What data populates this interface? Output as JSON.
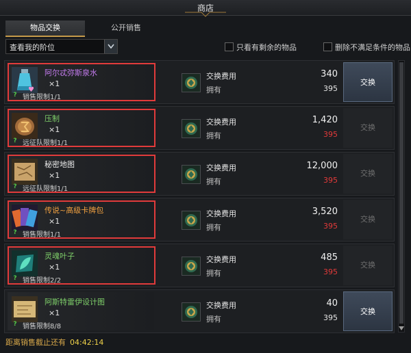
{
  "window": {
    "title": "商店"
  },
  "tabs": [
    {
      "label": "物品交换",
      "active": true
    },
    {
      "label": "公开销售",
      "active": false
    }
  ],
  "filter": {
    "selected": "查看我的阶位"
  },
  "checkboxes": [
    {
      "label": "只看有剩余的物品",
      "checked": false
    },
    {
      "label": "删除不满足条件的物品",
      "checked": false
    }
  ],
  "cost_label": "交换费用",
  "own_label": "拥有",
  "items": [
    {
      "name": "阿尔忒弥斯泉水",
      "name_color": "#c57cf0",
      "qty": "×1",
      "limit": "销售限制1/1",
      "cost": "340",
      "owned": "395",
      "affordable": true,
      "button": "交换",
      "icon": "potion-icon",
      "highlighted": true
    },
    {
      "name": "压制",
      "name_color": "#7fd06a",
      "qty": "×1",
      "limit": "远征队限制1/1",
      "cost": "1,420",
      "owned": "395",
      "affordable": false,
      "button": "交换",
      "icon": "rune-stone-icon",
      "highlighted": true
    },
    {
      "name": "秘密地图",
      "name_color": "#e8e8e8",
      "qty": "×1",
      "limit": "远征队限制1/1",
      "cost": "12,000",
      "owned": "395",
      "affordable": false,
      "button": "交换",
      "icon": "map-icon",
      "highlighted": true
    },
    {
      "name": "传说~高级卡牌包",
      "name_color": "#f0a040",
      "qty": "×1",
      "limit": "销售限制1/1",
      "cost": "3,520",
      "owned": "395",
      "affordable": false,
      "button": "交换",
      "icon": "card-pack-icon",
      "highlighted": true
    },
    {
      "name": "灵魂叶子",
      "name_color": "#7fd06a",
      "qty": "×1",
      "limit": "销售限制2/2",
      "cost": "485",
      "owned": "395",
      "affordable": false,
      "button": "交换",
      "icon": "soul-leaf-icon",
      "highlighted": true
    },
    {
      "name": "阿斯特雷伊设计图",
      "name_color": "#7fd06a",
      "qty": "×1",
      "limit": "销售限制8/8",
      "cost": "40",
      "owned": "395",
      "affordable": true,
      "button": "交换",
      "icon": "blueprint-icon",
      "highlighted": false
    }
  ],
  "footer": {
    "label": "距离销售截止还有",
    "time": "04:42:14"
  }
}
